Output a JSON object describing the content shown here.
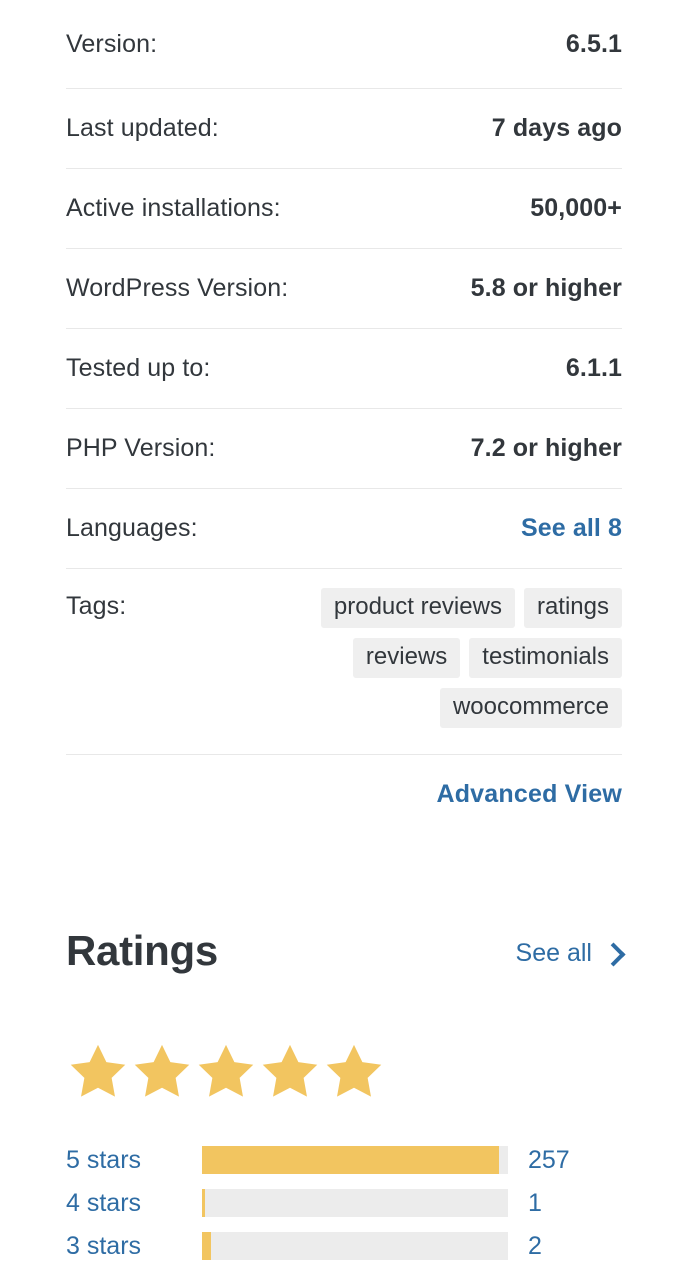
{
  "meta": {
    "rows": [
      {
        "label": "Version:",
        "value": "6.5.1",
        "is_link": false
      },
      {
        "label": "Last updated:",
        "value": "7 days ago",
        "is_link": false
      },
      {
        "label": "Active installations:",
        "value": "50,000+",
        "is_link": false
      },
      {
        "label": "WordPress Version:",
        "value": "5.8 or higher",
        "is_link": false
      },
      {
        "label": "Tested up to:",
        "value": "6.1.1",
        "is_link": false
      },
      {
        "label": "PHP Version:",
        "value": "7.2 or higher",
        "is_link": false
      },
      {
        "label": "Languages:",
        "value": "See all 8",
        "is_link": true
      }
    ]
  },
  "tags": {
    "label": "Tags:",
    "items": [
      "product reviews",
      "ratings",
      "reviews",
      "testimonials",
      "woocommerce"
    ]
  },
  "advanced": {
    "label": "Advanced View"
  },
  "ratings": {
    "title": "Ratings",
    "see_all_label": "See all",
    "chevron_icon": "chevron-right-icon",
    "star_icon": "star-filled-icon",
    "stars_filled": 5,
    "stars_total": 5,
    "bars": [
      {
        "label": "5 stars",
        "count": "257",
        "percent": 97
      },
      {
        "label": "4 stars",
        "count": "1",
        "percent": 1
      },
      {
        "label": "3 stars",
        "count": "2",
        "percent": 3
      }
    ]
  },
  "colors": {
    "link": "#2e6ca4",
    "star": "#f2c560",
    "bar_fill": "#f2c560",
    "bar_track": "#ececec",
    "tag_bg": "#efefef",
    "text": "#32373c",
    "divider": "#e8e8e8"
  }
}
